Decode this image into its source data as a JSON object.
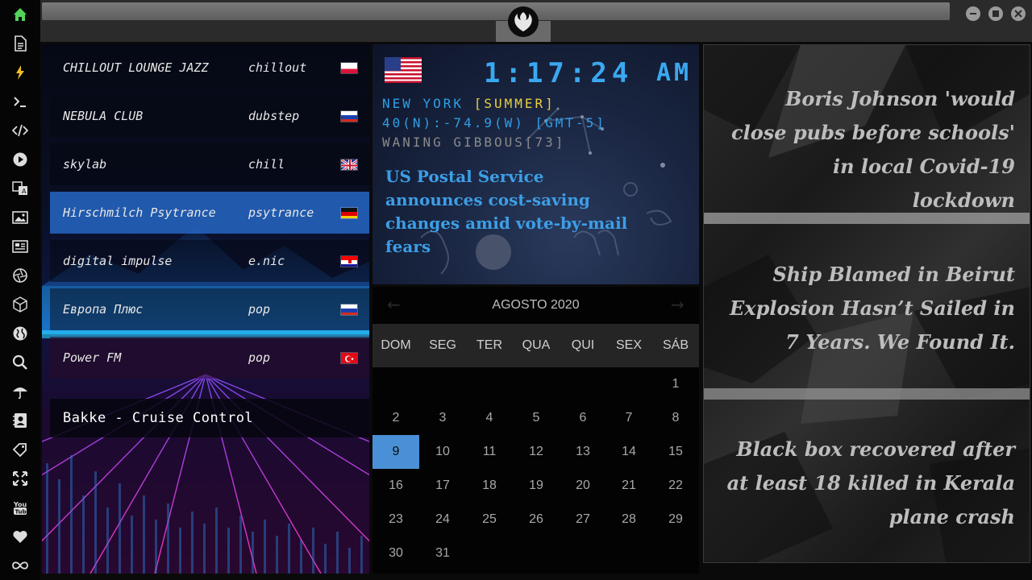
{
  "sidebar": {
    "icons": [
      "home-icon",
      "file-icon",
      "lightning-icon",
      "terminal-icon",
      "code-icon",
      "play-icon",
      "translate-icon",
      "image-icon",
      "news-icon",
      "aperture-icon",
      "cube-icon",
      "globe-icon",
      "search-icon",
      "umbrella-icon",
      "contact-icon",
      "tag-icon",
      "expand-icon",
      "youtube-icon",
      "heart-icon",
      "infinity-icon"
    ],
    "accent": "#54d35a"
  },
  "radio": {
    "stations": [
      {
        "name": "CHILLOUT LOUNGE JAZZ",
        "genre": "chillout",
        "flag": "poland",
        "active": false
      },
      {
        "name": "NEBULA CLUB",
        "genre": "dubstep",
        "flag": "russia",
        "active": false
      },
      {
        "name": "skylab",
        "genre": "chill",
        "flag": "uk",
        "active": false
      },
      {
        "name": "Hirschmilch Psytrance",
        "genre": "psytrance",
        "flag": "germany",
        "active": true
      },
      {
        "name": "digital impulse",
        "genre": "e.nic",
        "flag": "croatia",
        "active": false
      },
      {
        "name": "Европа Плюс",
        "genre": "pop",
        "flag": "russia",
        "active": false
      },
      {
        "name": "Power FM",
        "genre": "pop",
        "flag": "turkey",
        "active": false
      }
    ],
    "now_playing": "Bakke - Cruise Control"
  },
  "clock": {
    "flag": "usa",
    "time": "1:17:24",
    "ampm": "AM",
    "city": "NEW YORK",
    "season": "[SUMMER]",
    "coords": "40(N):-74.9(W) [GMT-5]",
    "moon": "WANING GIBBOUS[73]",
    "headline": "US Postal Service announces cost-saving changes amid vote-by-mail fears"
  },
  "calendar": {
    "title": "AGOSTO 2020",
    "prev": "←",
    "next": "→",
    "weekdays": [
      "DOM",
      "SEG",
      "TER",
      "QUA",
      "QUI",
      "SEX",
      "SÁB"
    ],
    "first_weekday_index": 6,
    "days_in_month": 31,
    "selected_day": 9,
    "selected_color": "#4a90d6"
  },
  "news": {
    "items": [
      "Boris Johnson 'would close pubs before schools' in local Covid-19 lockdown",
      "Ship Blamed in Beirut Explosion Hasn’t Sailed in 7 Years. We Found It.",
      "Black box recovered after at least 18 killed in Kerala plane crash"
    ]
  }
}
